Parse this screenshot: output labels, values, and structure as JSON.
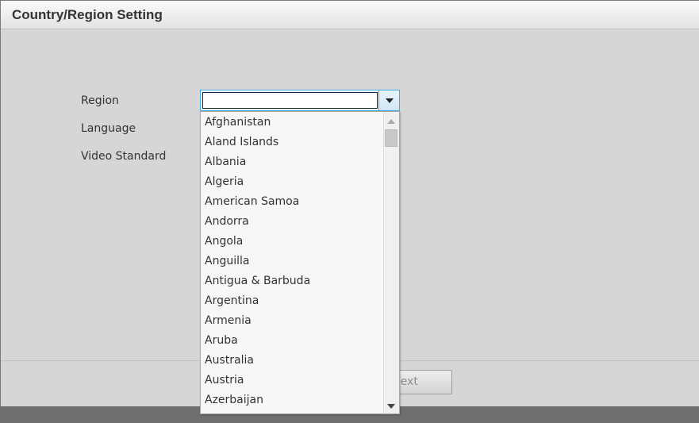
{
  "window": {
    "title": "Country/Region Setting"
  },
  "form": {
    "region_label": "Region",
    "language_label": "Language",
    "video_standard_label": "Video Standard",
    "region_value": ""
  },
  "dropdown": {
    "options": [
      "Afghanistan",
      "Aland Islands",
      "Albania",
      "Algeria",
      "American Samoa",
      "Andorra",
      "Angola",
      "Anguilla",
      "Antigua & Barbuda",
      "Argentina",
      "Armenia",
      "Aruba",
      "Australia",
      "Austria",
      "Azerbaijan"
    ]
  },
  "footer": {
    "next_label": "Next"
  }
}
